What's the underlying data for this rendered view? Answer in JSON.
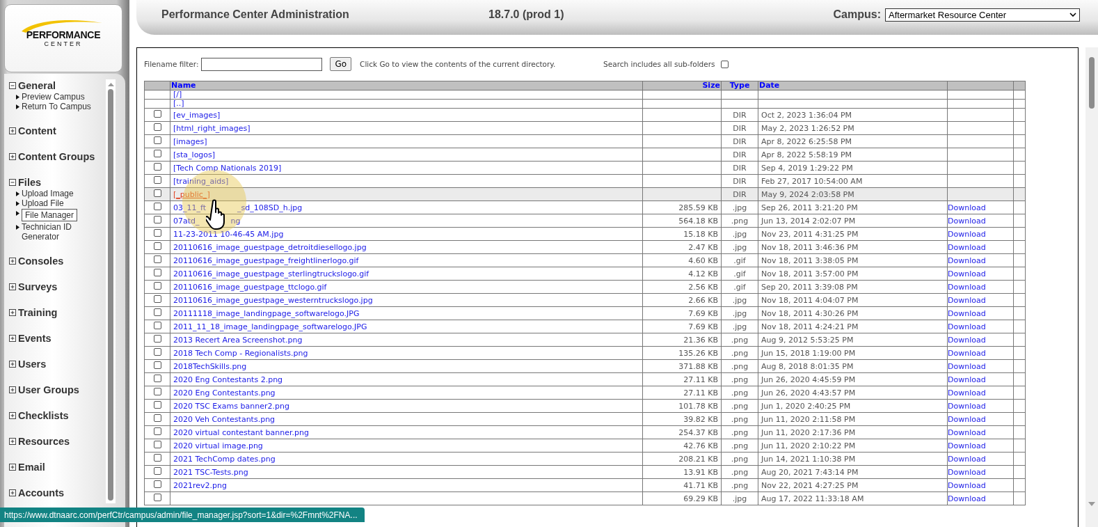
{
  "logo": {
    "line1": "PERFORMANCE",
    "line2": "CENTER"
  },
  "header": {
    "title": "Performance Center Administration",
    "version": "18.7.0 (prod 1)",
    "campus_label": "Campus:",
    "campus_value": "Aftermarket Resource Center"
  },
  "sidebar": {
    "sections": [
      {
        "label": "General",
        "expanded": true,
        "children": [
          {
            "label": "Preview Campus",
            "selected": false
          },
          {
            "label": "Return To Campus",
            "selected": false
          }
        ]
      },
      {
        "label": "Content",
        "expanded": false
      },
      {
        "label": "Content Groups",
        "expanded": false
      },
      {
        "label": "Files",
        "expanded": true,
        "children": [
          {
            "label": "Upload Image",
            "selected": false
          },
          {
            "label": "Upload File",
            "selected": false
          },
          {
            "label": "File Manager",
            "selected": true
          },
          {
            "label": "Technician ID Generator",
            "selected": false
          }
        ]
      },
      {
        "label": "Consoles",
        "expanded": false
      },
      {
        "label": "Surveys",
        "expanded": false
      },
      {
        "label": "Training",
        "expanded": false
      },
      {
        "label": "Events",
        "expanded": false
      },
      {
        "label": "Users",
        "expanded": false
      },
      {
        "label": "User Groups",
        "expanded": false
      },
      {
        "label": "Checklists",
        "expanded": false
      },
      {
        "label": "Resources",
        "expanded": false
      },
      {
        "label": "Email",
        "expanded": false
      },
      {
        "label": "Accounts",
        "expanded": false
      }
    ]
  },
  "filter": {
    "label": "Filename filter:",
    "button": "Go",
    "hint": "Click Go to view the contents of the current directory.",
    "subfolders_label": "Search includes all sub-folders",
    "subfolders_checked": false
  },
  "table": {
    "columns": [
      "Name",
      "Size",
      "Type",
      "Date"
    ],
    "nav_rows": [
      "[/]",
      "[..]"
    ],
    "rows": [
      {
        "name": "[ev_images]",
        "type": "DIR",
        "date": "Oct 2, 2023 1:36:04 PM",
        "checked": false,
        "highlighted": false
      },
      {
        "name": "[html_right_images]",
        "type": "DIR",
        "date": "May 2, 2023 1:26:52 PM",
        "checked": false,
        "highlighted": false
      },
      {
        "name": "[images]",
        "type": "DIR",
        "date": "Apr 8, 2022 6:25:58 PM",
        "checked": false,
        "highlighted": false
      },
      {
        "name": "[sta_logos]",
        "type": "DIR",
        "date": "Apr 8, 2022 5:58:19 PM",
        "checked": false,
        "highlighted": false
      },
      {
        "name": "[Tech Comp Nationals 2019]",
        "type": "DIR",
        "date": "Sep 4, 2019 1:29:22 PM",
        "checked": false,
        "highlighted": false
      },
      {
        "name": "[training_aids]",
        "type": "DIR",
        "date": "Feb 27, 2017 10:54:00 AM",
        "checked": false,
        "highlighted": false
      },
      {
        "name": "[_public_]",
        "type": "DIR",
        "date": "May 9, 2024 2:03:58 PM",
        "checked": false,
        "highlighted": true
      },
      {
        "name": "03_11_ft",
        "name_tail": "_sd_108SD_h.jpg",
        "size": "285.59 KB",
        "type": ".jpg",
        "date": "Sep 26, 2011 3:21:20 PM",
        "download": "Download",
        "checked": false,
        "highlighted": false
      },
      {
        "name": "07atd_",
        "name_tail": "ng",
        "size": "564.18 KB",
        "type": ".png",
        "date": "Jun 13, 2014 2:02:07 PM",
        "download": "Download",
        "checked": false,
        "highlighted": false
      },
      {
        "name": "11-23-2011 10-46-45 AM.jpg",
        "size": "15.18 KB",
        "type": ".jpg",
        "date": "Nov 23, 2011 4:31:25 PM",
        "download": "Download",
        "checked": false,
        "highlighted": false
      },
      {
        "name": "20110616_image_guestpage_detroitdiesellogo.jpg",
        "size": "2.47 KB",
        "type": ".jpg",
        "date": "Nov 18, 2011 3:46:36 PM",
        "download": "Download",
        "checked": false,
        "highlighted": false
      },
      {
        "name": "20110616_image_guestpage_freightlinerlogo.gif",
        "size": "4.60 KB",
        "type": ".gif",
        "date": "Nov 18, 2011 3:38:05 PM",
        "download": "Download",
        "checked": false,
        "highlighted": false
      },
      {
        "name": "20110616_image_guestpage_sterlingtruckslogo.gif",
        "size": "4.12 KB",
        "type": ".gif",
        "date": "Nov 18, 2011 3:57:00 PM",
        "download": "Download",
        "checked": false,
        "highlighted": false
      },
      {
        "name": "20110616_image_guestpage_ttclogo.gif",
        "size": "2.56 KB",
        "type": ".gif",
        "date": "Sep 20, 2011 3:39:08 PM",
        "download": "Download",
        "checked": false,
        "highlighted": false
      },
      {
        "name": "20110616_image_guestpage_westerntruckslogo.jpg",
        "size": "2.66 KB",
        "type": ".jpg",
        "date": "Nov 18, 2011 4:04:07 PM",
        "download": "Download",
        "checked": false,
        "highlighted": false
      },
      {
        "name": "20111118_image_landingpage_softwarelogo.JPG",
        "size": "7.69 KB",
        "type": ".jpg",
        "date": "Nov 18, 2011 4:30:26 PM",
        "download": "Download",
        "checked": false,
        "highlighted": false
      },
      {
        "name": "2011_11_18_image_landingpage_softwarelogo.JPG",
        "size": "7.69 KB",
        "type": ".jpg",
        "date": "Nov 18, 2011 4:24:21 PM",
        "download": "Download",
        "checked": false,
        "highlighted": false
      },
      {
        "name": "2013 Recert Area Screenshot.png",
        "size": "21.36 KB",
        "type": ".png",
        "date": "Aug 9, 2012 5:53:25 PM",
        "download": "Download",
        "checked": false,
        "highlighted": false
      },
      {
        "name": "2018 Tech Comp - Regionalists.png",
        "size": "135.26 KB",
        "type": ".png",
        "date": "Jun 15, 2018 1:19:00 PM",
        "download": "Download",
        "checked": false,
        "highlighted": false
      },
      {
        "name": "2018TechSkills.png",
        "size": "371.88 KB",
        "type": ".png",
        "date": "Aug 8, 2018 8:01:35 PM",
        "download": "Download",
        "checked": false,
        "highlighted": false
      },
      {
        "name": "2020 Eng Contestants 2.png",
        "size": "27.11 KB",
        "type": ".png",
        "date": "Jun 26, 2020 4:45:59 PM",
        "download": "Download",
        "checked": false,
        "highlighted": false
      },
      {
        "name": "2020 Eng Contestants.png",
        "size": "27.11 KB",
        "type": ".png",
        "date": "Jun 26, 2020 4:43:57 PM",
        "download": "Download",
        "checked": false,
        "highlighted": false
      },
      {
        "name": "2020 TSC Exams banner2.png",
        "size": "101.78 KB",
        "type": ".png",
        "date": "Jun 1, 2020 2:40:25 PM",
        "download": "Download",
        "checked": false,
        "highlighted": false
      },
      {
        "name": "2020 Veh Contestants.png",
        "size": "39.82 KB",
        "type": ".png",
        "date": "Jun 11, 2020 2:11:58 PM",
        "download": "Download",
        "checked": false,
        "highlighted": false
      },
      {
        "name": "2020 virtual contestant banner.png",
        "size": "254.37 KB",
        "type": ".png",
        "date": "Jun 11, 2020 2:17:36 PM",
        "download": "Download",
        "checked": false,
        "highlighted": false
      },
      {
        "name": "2020 virtual image.png",
        "size": "42.76 KB",
        "type": ".png",
        "date": "Jun 11, 2020 2:10:22 PM",
        "download": "Download",
        "checked": false,
        "highlighted": false
      },
      {
        "name": "2021 TechComp dates.png",
        "size": "208.21 KB",
        "type": ".png",
        "date": "Jun 14, 2021 1:10:38 PM",
        "download": "Download",
        "checked": false,
        "highlighted": false
      },
      {
        "name": "2021 TSC-Tests.png",
        "size": "13.91 KB",
        "type": ".png",
        "date": "Aug 20, 2021 7:43:14 PM",
        "download": "Download",
        "checked": false,
        "highlighted": false
      },
      {
        "name": "2021rev2.png",
        "size": "41.71 KB",
        "type": ".png",
        "date": "Nov 22, 2021 4:27:25 PM",
        "download": "Download",
        "checked": false,
        "highlighted": false
      },
      {
        "size": "69.29 KB",
        "type": ".jpg",
        "date": "Aug 17, 2022 11:33:18 AM",
        "download": "Download",
        "checked": false,
        "highlighted": false
      }
    ]
  },
  "status_url": "https://www.dtnaarc.com/perfCtr/campus/admin/file_manager.jsp?sort=1&dir=%2Fmnt%2FNA..."
}
